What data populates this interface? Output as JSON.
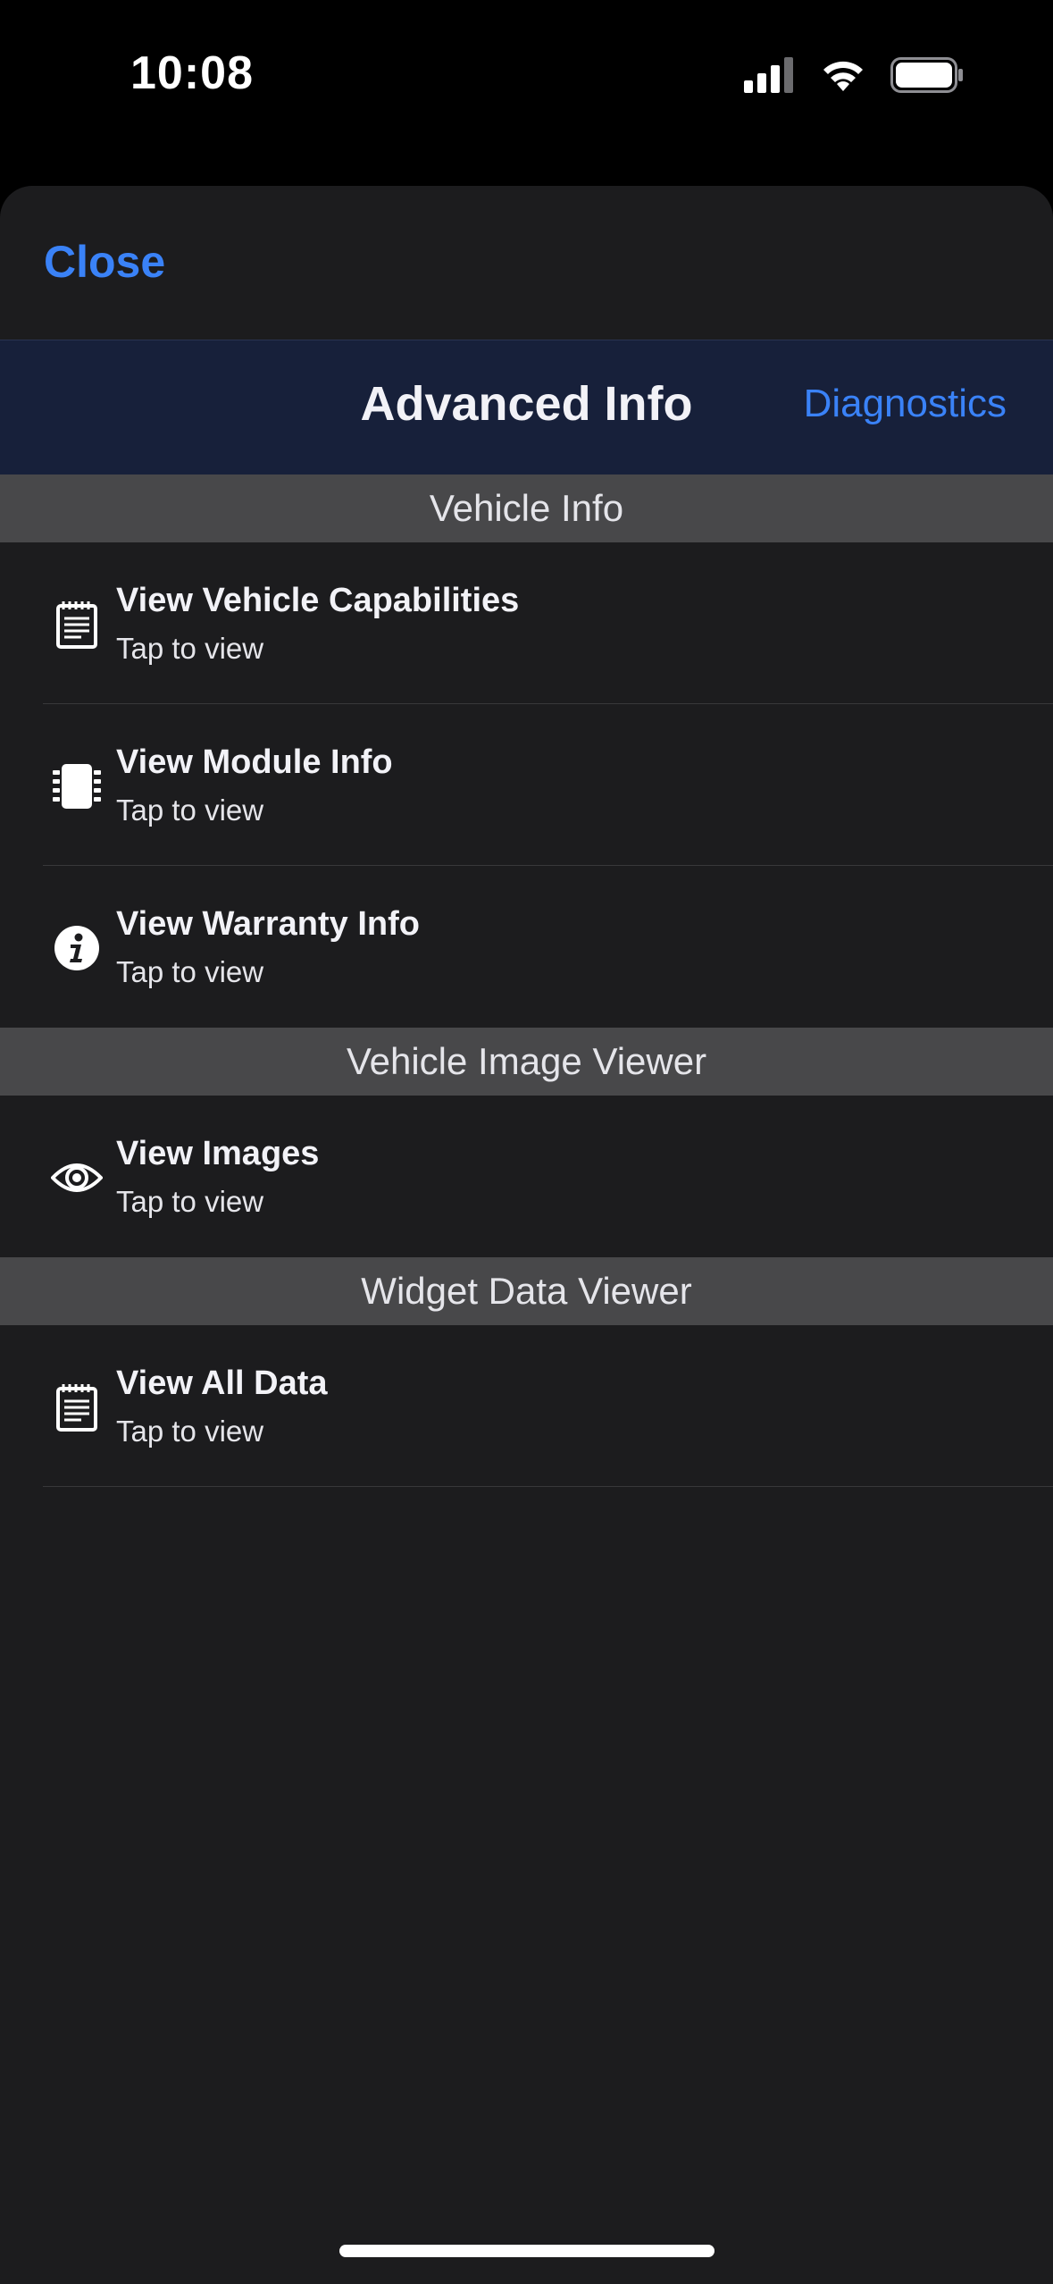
{
  "status_bar": {
    "time": "10:08",
    "icons": [
      "cellular-signal-icon",
      "wifi-icon",
      "battery-icon"
    ]
  },
  "sheet": {
    "close_label": "Close"
  },
  "navbar": {
    "title": "Advanced Info",
    "diagnostics_label": "Diagnostics"
  },
  "colors": {
    "accent": "#3a82f7",
    "sheet_background": "#1c1c1e",
    "navbar_background": "#17203a",
    "section_header_background": "#48484a"
  },
  "sections": [
    {
      "header": "Vehicle Info",
      "items": [
        {
          "title": "View Vehicle Capabilities",
          "subtitle": "Tap to view",
          "icon": "notepad-icon"
        },
        {
          "title": "View Module Info",
          "subtitle": "Tap to view",
          "icon": "chip-icon"
        },
        {
          "title": "View Warranty Info",
          "subtitle": "Tap to view",
          "icon": "info-icon"
        }
      ]
    },
    {
      "header": "Vehicle Image Viewer",
      "items": [
        {
          "title": "View Images",
          "subtitle": "Tap to view",
          "icon": "eye-icon"
        }
      ]
    },
    {
      "header": "Widget Data Viewer",
      "items": [
        {
          "title": "View All Data",
          "subtitle": "Tap to view",
          "icon": "notepad-icon"
        }
      ]
    }
  ]
}
